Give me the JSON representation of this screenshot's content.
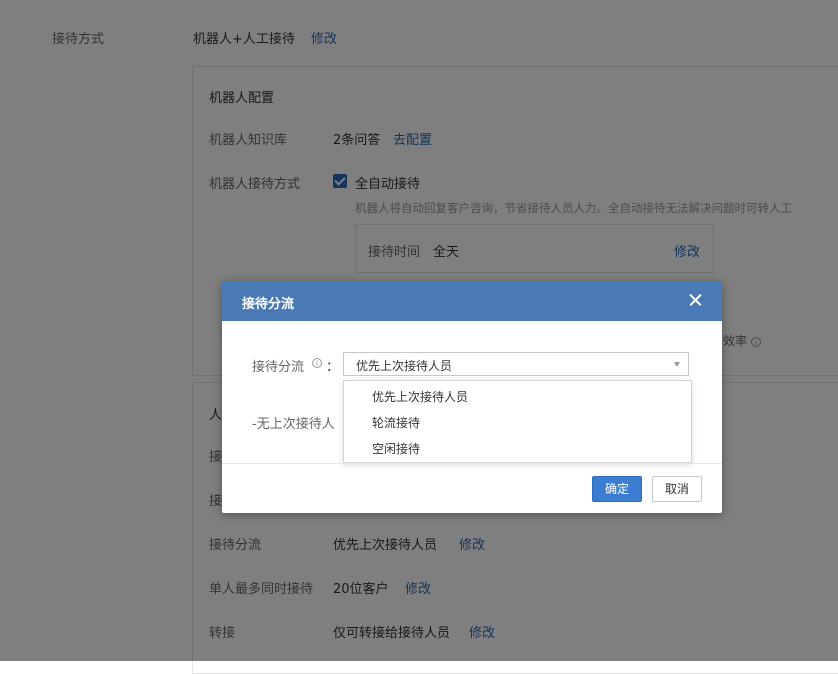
{
  "settings": {
    "reception_mode": {
      "label": "接待方式",
      "value": "机器人+人工接待",
      "action": "修改"
    },
    "robot": {
      "section_title": "机器人配置",
      "knowledge": {
        "label": "机器人知识库",
        "value": "2条问答",
        "action": "去配置"
      },
      "mode": {
        "label": "机器人接待方式",
        "checkbox_label": "全自动接待",
        "checked": true,
        "hint": "机器人将自动回复客户咨询，节省接待人员人力。全自动接待无法解决问题时可转人工",
        "time_label": "接待时间",
        "time_value": "全天",
        "time_action": "修改",
        "partial_hint": "效率"
      }
    },
    "human": {
      "section_title_partial": "人",
      "row1_label_partial": "接",
      "row2_label_partial": "接",
      "distribution": {
        "label": "接待分流",
        "value": "优先上次接待人员",
        "action": "修改"
      },
      "max_concurrent": {
        "label": "单人最多同时接待",
        "value": "20位客户",
        "action": "修改"
      },
      "transfer": {
        "label": "转接",
        "value": "仅可转接给接待人员",
        "action": "修改"
      }
    }
  },
  "modal": {
    "title": "接待分流",
    "field_label": "接待分流",
    "colon": "：",
    "info_icon": "i",
    "selected": "优先上次接待人员",
    "options": [
      "优先上次接待人员",
      "轮流接待",
      "空闲接待"
    ],
    "no_last_text": "-无上次接待人",
    "ok": "确定",
    "cancel": "取消"
  }
}
